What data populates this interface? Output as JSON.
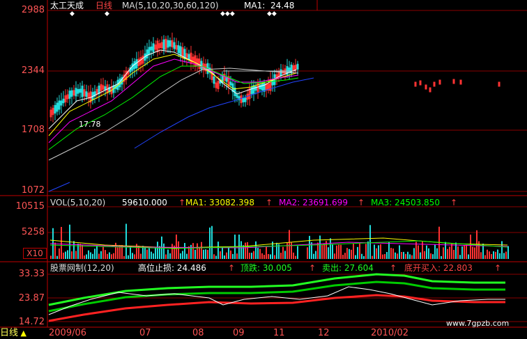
{
  "colors": {
    "frame": "#c00000",
    "axis_text": "#ff5555",
    "up_candle": "#ff3333",
    "down_candle": "#22dddd",
    "ma5": "#ffffff",
    "ma10": "#ffff00",
    "ma20": "#ff00ff",
    "ma30": "#00ff00",
    "ma60": "#cccccc",
    "ma120": "#2244ff",
    "band_top": "#22ff22",
    "band_mid": "#00cc00",
    "band_low": "#ff2222",
    "price_white": "#ffffff"
  },
  "main_chart": {
    "title": "太工天成",
    "period": "日线",
    "ma_params": "MA(5,10,20,30,60,120)",
    "ma1_label": "MA1:",
    "ma1_value": "24.48",
    "y_ticks": [
      "2988",
      "2344",
      "1708",
      "1072"
    ],
    "low_marker": "17.78",
    "marker_glyphs": [
      "◆",
      "◆",
      "◆◆◆",
      "◆◆"
    ]
  },
  "volume_chart": {
    "label": "VOL(5,10,20)",
    "value": "59610.000",
    "ma1": "MA1: 33082.398",
    "ma2": "MA2: 23691.699",
    "ma3": "MA3: 24503.850",
    "arrow": "↑",
    "y_ticks": [
      "10515",
      "5258"
    ],
    "multiplier": "X10"
  },
  "indicator_chart": {
    "label": "股票网制(12,20)",
    "stop_loss": "高位止损: 24.486",
    "top_fall": "顶跌: 30.005",
    "sell": "卖出: 27.604",
    "bottom_buy": "底开买入: 22.803",
    "arrow": "↑",
    "y_ticks": [
      "33.33",
      "23.87",
      "14.72"
    ]
  },
  "x_axis": {
    "period_label": "日线",
    "labels": [
      "2009/06",
      "07",
      "08",
      "09",
      "11",
      "12",
      "2010/02"
    ]
  },
  "watermark": "www.7gpzb.com"
}
